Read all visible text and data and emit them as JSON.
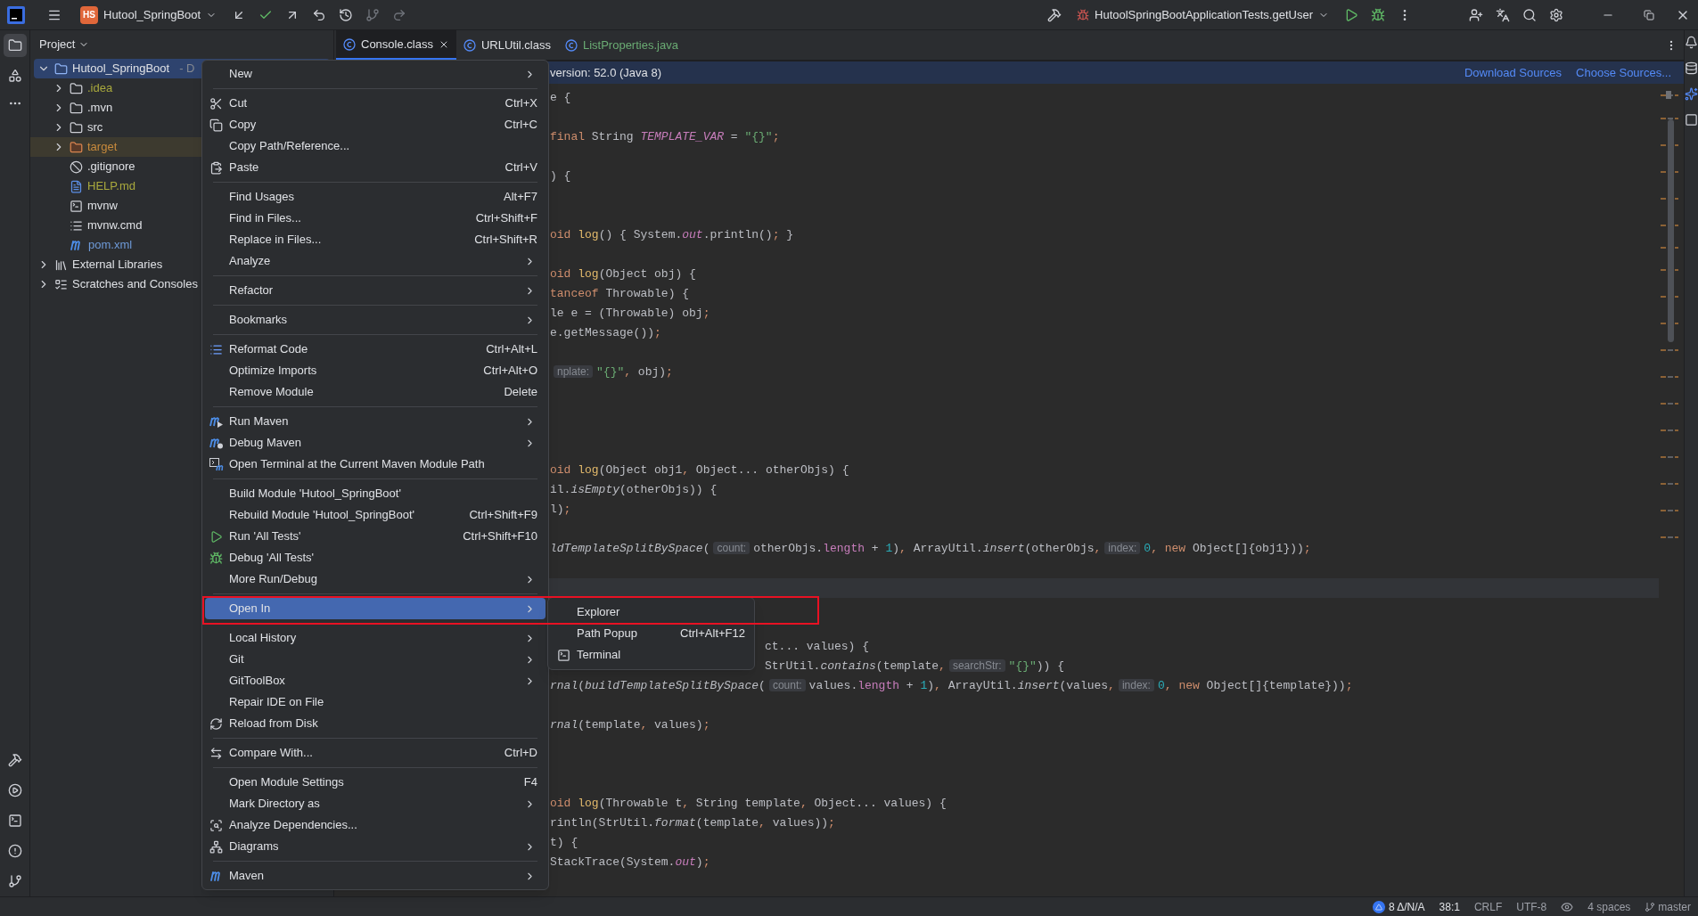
{
  "toolbar": {
    "project_badge": "HS",
    "project": "Hutool_SpringBoot",
    "run_config": "HutoolSpringBootApplicationTests.getUser"
  },
  "project_panel": {
    "title": "Project",
    "tree": [
      {
        "label": "Hutool_SpringBoot",
        "suffix": "- D",
        "kind": "module",
        "expanded": true,
        "selected": true,
        "children": [
          {
            "label": ".idea",
            "kind": "folder",
            "color": "#a9a93d",
            "expanded": false,
            "selected": false
          },
          {
            "label": ".mvn",
            "kind": "folder",
            "color": "#dfe1e5",
            "expanded": false,
            "selected": false
          },
          {
            "label": "src",
            "kind": "folder",
            "color": "#dfe1e5",
            "expanded": false,
            "selected": false
          },
          {
            "label": "target",
            "kind": "excluded-folder",
            "color": "#c88a3c",
            "expanded": false,
            "selected": false
          },
          {
            "label": ".gitignore",
            "kind": "ignore-file",
            "color": "#dfe1e5",
            "selected": false
          },
          {
            "label": "HELP.md",
            "kind": "markdown",
            "color": "#a9a93d",
            "selected": false
          },
          {
            "label": "mvnw",
            "kind": "script",
            "color": "#dfe1e5",
            "selected": false
          },
          {
            "label": "mvnw.cmd",
            "kind": "text-file",
            "color": "#dfe1e5",
            "selected": false
          },
          {
            "label": "pom.xml",
            "kind": "maven",
            "color": "#6e9ad8",
            "selected": false
          }
        ]
      },
      {
        "label": "External Libraries",
        "kind": "libraries",
        "color": "#dfe1e5",
        "expanded": false,
        "selected": false
      },
      {
        "label": "Scratches and Consoles",
        "kind": "scratches",
        "color": "#dfe1e5",
        "expanded": false,
        "selected": false
      }
    ]
  },
  "editor": {
    "tabs": [
      {
        "label": "Console.class",
        "selected": true,
        "color": "#dfe1e5"
      },
      {
        "label": "URLUtil.class",
        "selected": false,
        "color": "#dfe1e5"
      },
      {
        "label": "ListProperties.java",
        "selected": false,
        "color": "#6aab73"
      }
    ],
    "banner": {
      "text": "version: 52.0 (Java 8)",
      "links": [
        "Download Sources",
        "Choose Sources..."
      ]
    },
    "code_lines": [
      {
        "kind": "code",
        "segments": [
          {
            "kind": "plain",
            "text": "e {"
          }
        ]
      },
      {
        "kind": "blank"
      },
      {
        "kind": "code",
        "segments": [
          {
            "kind": "keyword",
            "text": "final "
          },
          {
            "kind": "plain",
            "text": "String "
          },
          {
            "kind": "static-field",
            "text": "TEMPLATE_VAR"
          },
          {
            "kind": "plain",
            "text": " = "
          },
          {
            "kind": "string",
            "text": "\"{}\""
          },
          {
            "kind": "punct",
            "text": ";"
          }
        ]
      },
      {
        "kind": "blank"
      },
      {
        "kind": "code",
        "segments": [
          {
            "kind": "plain",
            "text": ") {"
          }
        ]
      },
      {
        "kind": "blank"
      },
      {
        "kind": "blank"
      },
      {
        "kind": "code",
        "segments": [
          {
            "kind": "keyword",
            "text": "oid "
          },
          {
            "kind": "method",
            "text": "log"
          },
          {
            "kind": "plain",
            "text": "() { System."
          },
          {
            "kind": "static-field",
            "text": "out"
          },
          {
            "kind": "plain",
            "text": ".println()"
          },
          {
            "kind": "punct",
            "text": ";"
          },
          {
            "kind": "plain",
            "text": " }"
          }
        ]
      },
      {
        "kind": "blank"
      },
      {
        "kind": "code",
        "segments": [
          {
            "kind": "keyword",
            "text": "oid "
          },
          {
            "kind": "method",
            "text": "log"
          },
          {
            "kind": "plain",
            "text": "(Object obj) {"
          }
        ]
      },
      {
        "kind": "code",
        "segments": [
          {
            "kind": "keyword",
            "text": "tanceof "
          },
          {
            "kind": "plain",
            "text": "Throwable) {"
          }
        ]
      },
      {
        "kind": "code",
        "segments": [
          {
            "kind": "plain",
            "text": "le e = (Throwable) obj"
          },
          {
            "kind": "punct",
            "text": ";"
          }
        ]
      },
      {
        "kind": "code",
        "segments": [
          {
            "kind": "plain",
            "text": "e.getMessage())"
          },
          {
            "kind": "punct",
            "text": ";"
          }
        ]
      },
      {
        "kind": "blank"
      },
      {
        "kind": "code",
        "segments": [
          {
            "kind": "hint",
            "text": "nplate:"
          },
          {
            "kind": "string",
            "text": "\"{}\""
          },
          {
            "kind": "punct",
            "text": ","
          },
          {
            "kind": "plain",
            "text": " obj)"
          },
          {
            "kind": "punct",
            "text": ";"
          }
        ]
      },
      {
        "kind": "blank"
      },
      {
        "kind": "blank"
      },
      {
        "kind": "blank"
      },
      {
        "kind": "blank"
      },
      {
        "kind": "code",
        "segments": [
          {
            "kind": "keyword",
            "text": "oid "
          },
          {
            "kind": "method",
            "text": "log"
          },
          {
            "kind": "plain",
            "text": "(Object obj1"
          },
          {
            "kind": "punct",
            "text": ","
          },
          {
            "kind": "plain",
            "text": " Object... otherObjs) {"
          }
        ]
      },
      {
        "kind": "code",
        "segments": [
          {
            "kind": "plain",
            "text": "il."
          },
          {
            "kind": "italic",
            "text": "isEmpty"
          },
          {
            "kind": "plain",
            "text": "(otherObjs)) {"
          }
        ]
      },
      {
        "kind": "code",
        "segments": [
          {
            "kind": "plain",
            "text": "l)"
          },
          {
            "kind": "punct",
            "text": ";"
          }
        ]
      },
      {
        "kind": "blank"
      },
      {
        "kind": "code",
        "segments": [
          {
            "kind": "italic",
            "text": "ldTemplateSplitBySpace"
          },
          {
            "kind": "plain",
            "text": "("
          },
          {
            "kind": "hint",
            "text": "count:"
          },
          {
            "kind": "plain",
            "text": "otherObjs."
          },
          {
            "kind": "field",
            "text": "length"
          },
          {
            "kind": "plain",
            "text": " + "
          },
          {
            "kind": "number",
            "text": "1"
          },
          {
            "kind": "plain",
            "text": ")"
          },
          {
            "kind": "punct",
            "text": ","
          },
          {
            "kind": "plain",
            "text": " ArrayUtil."
          },
          {
            "kind": "italic",
            "text": "insert"
          },
          {
            "kind": "plain",
            "text": "(otherObjs"
          },
          {
            "kind": "punct",
            "text": ","
          },
          {
            "kind": "hint",
            "text": "index:"
          },
          {
            "kind": "number",
            "text": "0"
          },
          {
            "kind": "punct",
            "text": ","
          },
          {
            "kind": "keyword",
            "text": " new "
          },
          {
            "kind": "plain",
            "text": "Object[]{obj1}))"
          },
          {
            "kind": "punct",
            "text": ";"
          }
        ]
      },
      {
        "kind": "blank"
      },
      {
        "kind": "current-line"
      },
      {
        "kind": "blank"
      },
      {
        "kind": "blank"
      },
      {
        "kind": "after-popup",
        "segments": [
          {
            "kind": "plain",
            "text": "ct... values) {"
          }
        ]
      },
      {
        "kind": "after-popup",
        "segments": [
          {
            "kind": "plain",
            "text": "StrUtil."
          },
          {
            "kind": "italic",
            "text": "contains"
          },
          {
            "kind": "plain",
            "text": "(template"
          },
          {
            "kind": "punct",
            "text": ","
          },
          {
            "kind": "hint",
            "text": "searchStr:"
          },
          {
            "kind": "string",
            "text": "\"{}\""
          },
          {
            "kind": "plain",
            "text": ")) {"
          }
        ]
      },
      {
        "kind": "code",
        "segments": [
          {
            "kind": "italic",
            "text": "rnal"
          },
          {
            "kind": "plain",
            "text": "("
          },
          {
            "kind": "italic",
            "text": "buildTemplateSplitBySpace"
          },
          {
            "kind": "plain",
            "text": "("
          },
          {
            "kind": "hint",
            "text": "count:"
          },
          {
            "kind": "plain",
            "text": "values."
          },
          {
            "kind": "field",
            "text": "length"
          },
          {
            "kind": "plain",
            "text": " + "
          },
          {
            "kind": "number",
            "text": "1"
          },
          {
            "kind": "plain",
            "text": ")"
          },
          {
            "kind": "punct",
            "text": ","
          },
          {
            "kind": "plain",
            "text": " ArrayUtil."
          },
          {
            "kind": "italic",
            "text": "insert"
          },
          {
            "kind": "plain",
            "text": "(values"
          },
          {
            "kind": "punct",
            "text": ","
          },
          {
            "kind": "hint",
            "text": "index:"
          },
          {
            "kind": "number",
            "text": "0"
          },
          {
            "kind": "punct",
            "text": ","
          },
          {
            "kind": "keyword",
            "text": " new "
          },
          {
            "kind": "plain",
            "text": "Object[]{template}))"
          },
          {
            "kind": "punct",
            "text": ";"
          }
        ]
      },
      {
        "kind": "blank"
      },
      {
        "kind": "code",
        "segments": [
          {
            "kind": "italic",
            "text": "rnal"
          },
          {
            "kind": "plain",
            "text": "(template"
          },
          {
            "kind": "punct",
            "text": ","
          },
          {
            "kind": "plain",
            "text": " values)"
          },
          {
            "kind": "punct",
            "text": ";"
          }
        ]
      },
      {
        "kind": "blank"
      },
      {
        "kind": "blank"
      },
      {
        "kind": "blank"
      },
      {
        "kind": "code",
        "segments": [
          {
            "kind": "keyword",
            "text": "oid "
          },
          {
            "kind": "method",
            "text": "log"
          },
          {
            "kind": "plain",
            "text": "(Throwable t"
          },
          {
            "kind": "punct",
            "text": ","
          },
          {
            "kind": "plain",
            "text": " String template"
          },
          {
            "kind": "punct",
            "text": ","
          },
          {
            "kind": "plain",
            "text": " Object... values) {"
          }
        ]
      },
      {
        "kind": "code",
        "segments": [
          {
            "kind": "plain",
            "text": "rintln(StrUtil."
          },
          {
            "kind": "italic",
            "text": "format"
          },
          {
            "kind": "plain",
            "text": "(template"
          },
          {
            "kind": "punct",
            "text": ","
          },
          {
            "kind": "plain",
            "text": " values))"
          },
          {
            "kind": "punct",
            "text": ";"
          }
        ]
      },
      {
        "kind": "code",
        "segments": [
          {
            "kind": "plain",
            "text": "t) {"
          }
        ]
      },
      {
        "kind": "code",
        "segments": [
          {
            "kind": "plain",
            "text": "StackTrace(System."
          },
          {
            "kind": "static-field",
            "text": "out"
          },
          {
            "kind": "plain",
            "text": ")"
          },
          {
            "kind": "punct",
            "text": ";"
          }
        ]
      }
    ]
  },
  "context_menu": {
    "groups": [
      [
        {
          "label": "New",
          "kind": "plain",
          "submenu": true,
          "selected": false
        }
      ],
      [
        {
          "label": "Cut",
          "kind": "scissors",
          "shortcut": "Ctrl+X",
          "submenu": false,
          "selected": false
        },
        {
          "label": "Copy",
          "kind": "copy",
          "shortcut": "Ctrl+C",
          "submenu": false,
          "selected": false
        },
        {
          "label": "Copy Path/Reference...",
          "kind": "plain",
          "submenu": false,
          "selected": false
        },
        {
          "label": "Paste",
          "kind": "paste",
          "shortcut": "Ctrl+V",
          "submenu": false,
          "selected": false
        }
      ],
      [
        {
          "label": "Find Usages",
          "kind": "plain",
          "shortcut": "Alt+F7",
          "submenu": false,
          "selected": false
        },
        {
          "label": "Find in Files...",
          "kind": "plain",
          "shortcut": "Ctrl+Shift+F",
          "submenu": false,
          "selected": false
        },
        {
          "label": "Replace in Files...",
          "kind": "plain",
          "shortcut": "Ctrl+Shift+R",
          "submenu": false,
          "selected": false
        },
        {
          "label": "Analyze",
          "kind": "plain",
          "submenu": true,
          "selected": false
        }
      ],
      [
        {
          "label": "Refactor",
          "kind": "plain",
          "submenu": true,
          "selected": false
        }
      ],
      [
        {
          "label": "Bookmarks",
          "kind": "plain",
          "submenu": true,
          "selected": false
        }
      ],
      [
        {
          "label": "Reformat Code",
          "kind": "reformat",
          "shortcut": "Ctrl+Alt+L",
          "submenu": false,
          "selected": false
        },
        {
          "label": "Optimize Imports",
          "kind": "plain",
          "shortcut": "Ctrl+Alt+O",
          "submenu": false,
          "selected": false
        },
        {
          "label": "Remove Module",
          "kind": "plain",
          "shortcut": "Delete",
          "submenu": false,
          "selected": false
        }
      ],
      [
        {
          "label": "Run Maven",
          "kind": "maven-run",
          "submenu": true,
          "selected": false
        },
        {
          "label": "Debug Maven",
          "kind": "maven-debug",
          "submenu": true,
          "selected": false
        },
        {
          "label": "Open Terminal at the Current Maven Module Path",
          "kind": "maven-terminal",
          "submenu": false,
          "selected": false
        }
      ],
      [
        {
          "label": "Build Module 'Hutool_SpringBoot'",
          "kind": "plain",
          "submenu": false,
          "selected": false
        },
        {
          "label": "Rebuild Module 'Hutool_SpringBoot'",
          "kind": "plain",
          "shortcut": "Ctrl+Shift+F9",
          "submenu": false,
          "selected": false
        },
        {
          "label": "Run 'All Tests'",
          "kind": "run",
          "shortcut": "Ctrl+Shift+F10",
          "submenu": false,
          "selected": false
        },
        {
          "label": "Debug 'All Tests'",
          "kind": "debug",
          "submenu": false,
          "selected": false
        },
        {
          "label": "More Run/Debug",
          "kind": "plain",
          "submenu": true,
          "selected": false
        }
      ],
      [
        {
          "label": "Open In",
          "kind": "plain",
          "submenu": true,
          "selected": true
        }
      ],
      [
        {
          "label": "Local History",
          "kind": "plain",
          "submenu": true,
          "selected": false
        },
        {
          "label": "Git",
          "kind": "plain",
          "submenu": true,
          "selected": false
        },
        {
          "label": "GitToolBox",
          "kind": "plain",
          "submenu": true,
          "selected": false
        },
        {
          "label": "Repair IDE on File",
          "kind": "plain",
          "submenu": false,
          "selected": false
        },
        {
          "label": "Reload from Disk",
          "kind": "reload",
          "submenu": false,
          "selected": false
        }
      ],
      [
        {
          "label": "Compare With...",
          "kind": "compare",
          "shortcut": "Ctrl+D",
          "submenu": false,
          "selected": false
        }
      ],
      [
        {
          "label": "Open Module Settings",
          "kind": "plain",
          "shortcut": "F4",
          "submenu": false,
          "selected": false
        },
        {
          "label": "Mark Directory as",
          "kind": "plain",
          "submenu": true,
          "selected": false
        },
        {
          "label": "Analyze Dependencies...",
          "kind": "dependencies",
          "submenu": false,
          "selected": false
        },
        {
          "label": "Diagrams",
          "kind": "diagrams",
          "submenu": true,
          "selected": false
        }
      ],
      [
        {
          "label": "Maven",
          "kind": "maven",
          "submenu": true,
          "selected": false
        }
      ]
    ]
  },
  "open_in_submenu": [
    {
      "label": "Explorer",
      "kind": "plain"
    },
    {
      "label": "Path Popup",
      "kind": "plain",
      "shortcut": "Ctrl+Alt+F12"
    },
    {
      "label": "Terminal",
      "kind": "terminal"
    }
  ],
  "highlight_frame": true,
  "status_bar": {
    "problems": "8 Δ/N/A",
    "position": "38:1",
    "line_ending": "CRLF",
    "encoding": "UTF-8",
    "indent": "4 spaces",
    "branch": "master"
  }
}
